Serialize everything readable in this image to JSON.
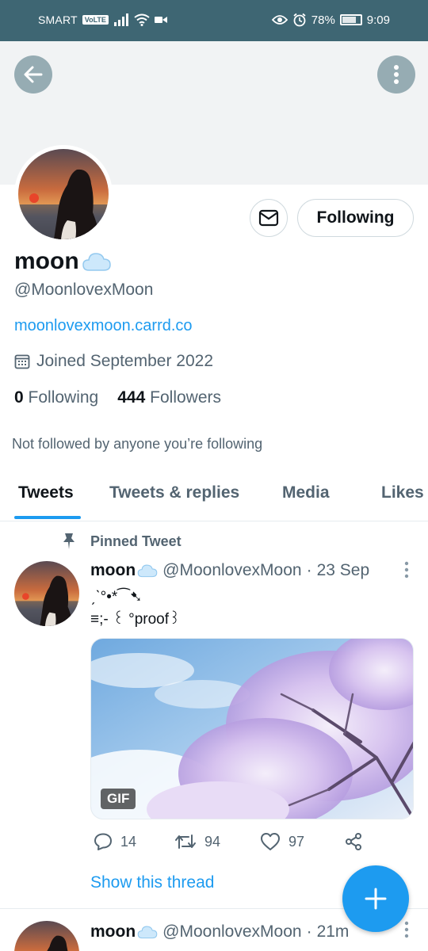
{
  "status_bar": {
    "carrier": "SMART",
    "volte": "VoLTE",
    "battery": "78%",
    "battery_level": 0.78,
    "time": "9:09"
  },
  "profile": {
    "name": "moon",
    "handle": "@MoonlovexMoon",
    "link": "moonlovexmoon.carrd.co",
    "joined": "Joined September 2022",
    "following_count": "0",
    "following_label": "Following",
    "followers_count": "444",
    "followers_label": "Followers",
    "not_followed_text": "Not followed by anyone you’re following",
    "follow_button_label": "Following"
  },
  "tabs": [
    {
      "label": "Tweets",
      "active": true
    },
    {
      "label": "Tweets & replies",
      "active": false
    },
    {
      "label": "Media",
      "active": false
    },
    {
      "label": "Likes",
      "active": false
    }
  ],
  "pinned_tweet": {
    "pinned_label": "Pinned Tweet",
    "name": "moon",
    "handle": "@MoonlovexMoon",
    "separator": "·",
    "time": "23 Sep",
    "text_line1": "ˏˋ°•*⁀➷",
    "text_line2": "≡;- ꒰ °proof꒱",
    "media_badge": "GIF",
    "replies": "14",
    "retweets": "94",
    "likes": "97",
    "show_thread": "Show this thread"
  },
  "next_tweet": {
    "name": "moon",
    "handle": "@MoonlovexMoon",
    "separator": "·",
    "time": "21m"
  },
  "colors": {
    "status_bar": "#3e6673",
    "accent": "#1d9bf0",
    "banner": "#f1f3f4",
    "secondary_text": "#536471"
  }
}
